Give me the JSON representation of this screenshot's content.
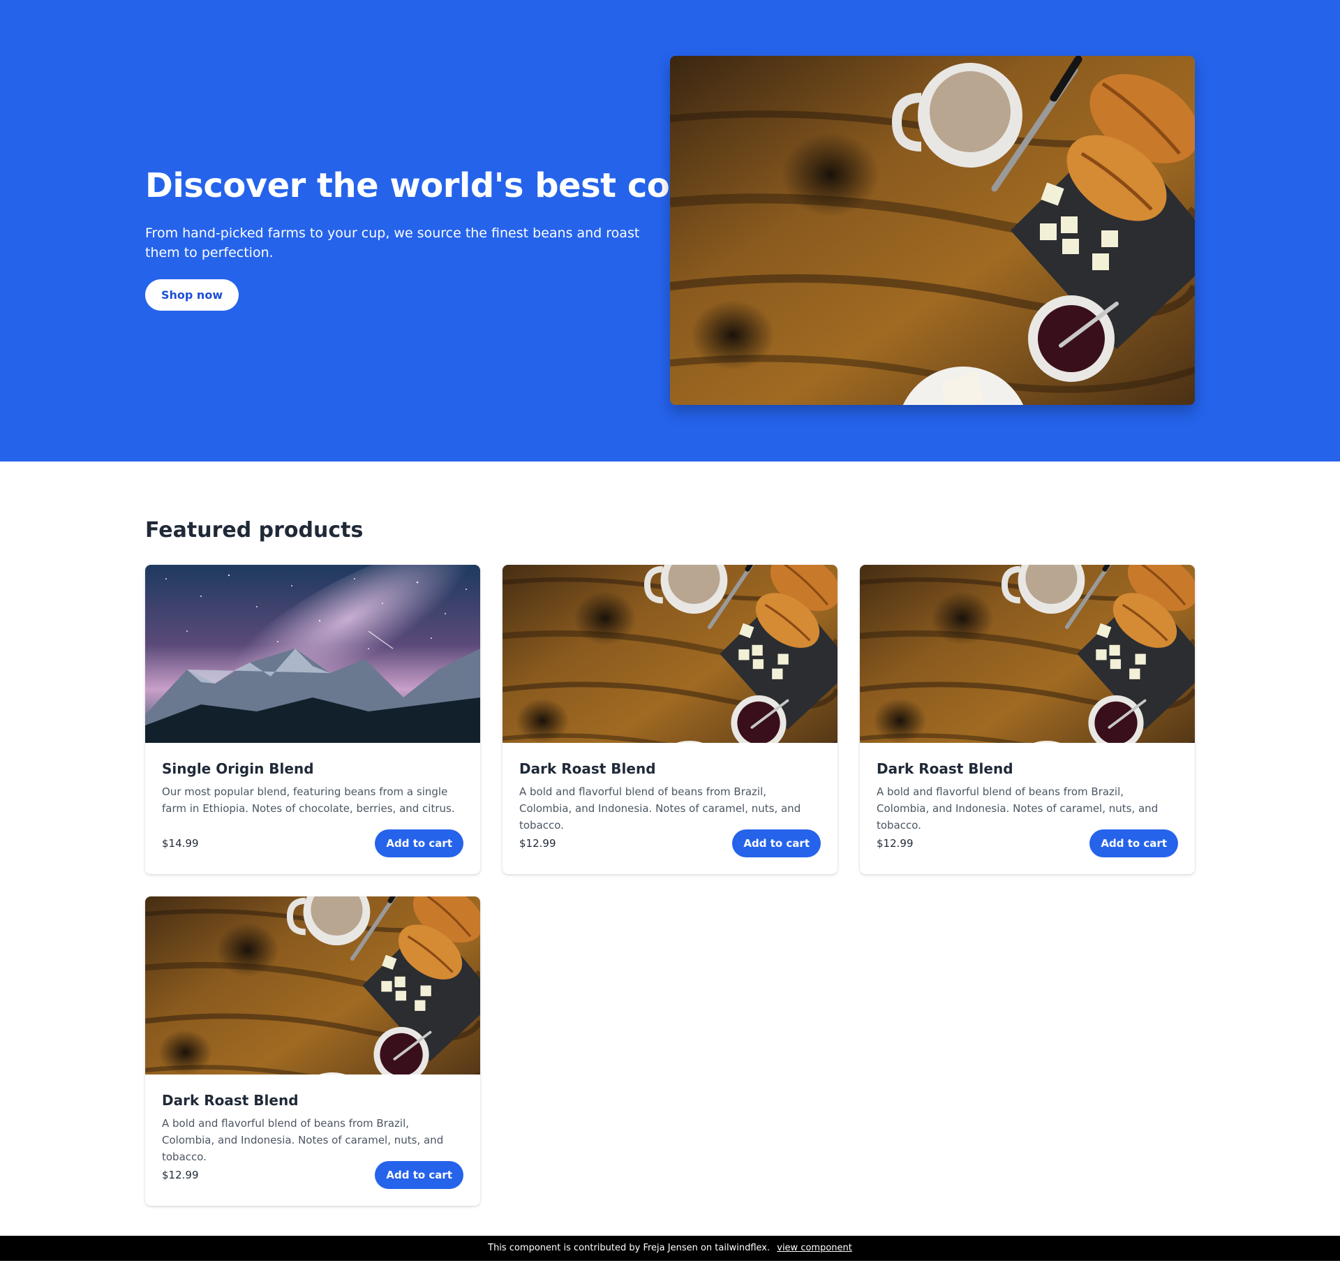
{
  "hero": {
    "title": "Discover the world's best coffee",
    "subtitle": "From hand-picked farms to your cup, we source the finest beans and roast them to perfection.",
    "cta_label": "Shop now",
    "image": "coffee-breakfast-photo"
  },
  "featured": {
    "title": "Featured products",
    "products": [
      {
        "image": "mountain-night-sky-photo",
        "name": "Single Origin Blend",
        "description": "Our most popular blend, featuring beans from a single farm in Ethiopia. Notes of chocolate, berries, and citrus.",
        "price": "$14.99",
        "button_label": "Add to cart"
      },
      {
        "image": "coffee-breakfast-photo",
        "name": "Dark Roast Blend",
        "description": "A bold and flavorful blend of beans from Brazil, Colombia, and Indonesia. Notes of caramel, nuts, and tobacco.",
        "price": "$12.99",
        "button_label": "Add to cart"
      },
      {
        "image": "coffee-breakfast-photo",
        "name": "Dark Roast Blend",
        "description": "A bold and flavorful blend of beans from Brazil, Colombia, and Indonesia. Notes of caramel, nuts, and tobacco.",
        "price": "$12.99",
        "button_label": "Add to cart"
      },
      {
        "image": "coffee-breakfast-photo",
        "name": "Dark Roast Blend",
        "description": "A bold and flavorful blend of beans from Brazil, Colombia, and Indonesia. Notes of caramel, nuts, and tobacco.",
        "price": "$12.99",
        "button_label": "Add to cart"
      }
    ]
  },
  "footer": {
    "text": "This component is contributed by Freja Jensen on tailwindflex.",
    "link_label": "view component"
  },
  "colors": {
    "brand_blue": "#2563eb",
    "heading": "#1f2937",
    "body_text": "#4b5563",
    "footer_bg": "#000000"
  }
}
